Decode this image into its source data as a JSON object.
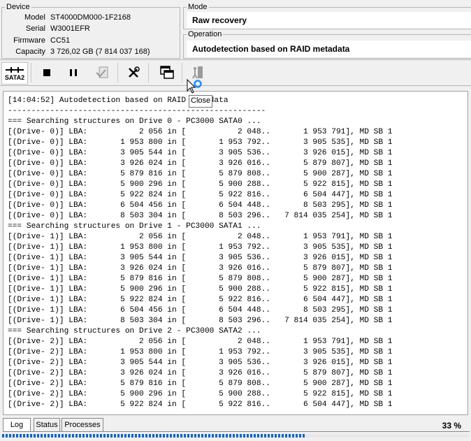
{
  "device": {
    "legend": "Device",
    "rows": [
      {
        "key": "Model",
        "value": "ST4000DM000-1F2168"
      },
      {
        "key": "Serial",
        "value": "W3001EFR"
      },
      {
        "key": "Firmware",
        "value": "CC51"
      },
      {
        "key": "Capacity",
        "value": "3 726,02 GB (7 814 037 168)"
      }
    ]
  },
  "mode": {
    "legend": "Mode",
    "value": "Raw recovery"
  },
  "operation": {
    "legend": "Operation",
    "value": "Autodetection based on RAID metadata"
  },
  "toolbar": {
    "sata_label": "SATA2",
    "tooltip": "Close"
  },
  "log": {
    "lines": [
      "[14:04:52] Autodetection based on RAID metadata",
      "-------------------------------------------------------",
      "=== Searching structures on Drive 0 - PC3000 SATA0 ...",
      "[(Drive- 0)] LBA:           2 056 in [           2 048..       1 953 791], MD SB 1",
      "[(Drive- 0)] LBA:       1 953 800 in [       1 953 792..       3 905 535], MD SB 1",
      "[(Drive- 0)] LBA:       3 905 544 in [       3 905 536..       3 926 015], MD SB 1",
      "[(Drive- 0)] LBA:       3 926 024 in [       3 926 016..       5 879 807], MD SB 1",
      "[(Drive- 0)] LBA:       5 879 816 in [       5 879 808..       5 900 287], MD SB 1",
      "[(Drive- 0)] LBA:       5 900 296 in [       5 900 288..       5 922 815], MD SB 1",
      "[(Drive- 0)] LBA:       5 922 824 in [       5 922 816..       6 504 447], MD SB 1",
      "[(Drive- 0)] LBA:       6 504 456 in [       6 504 448..       8 503 295], MD SB 1",
      "[(Drive- 0)] LBA:       8 503 304 in [       8 503 296..   7 814 035 254], MD SB 1",
      "=== Searching structures on Drive 1 - PC3000 SATA1 ...",
      "[(Drive- 1)] LBA:           2 056 in [           2 048..       1 953 791], MD SB 1",
      "[(Drive- 1)] LBA:       1 953 800 in [       1 953 792..       3 905 535], MD SB 1",
      "[(Drive- 1)] LBA:       3 905 544 in [       3 905 536..       3 926 015], MD SB 1",
      "[(Drive- 1)] LBA:       3 926 024 in [       3 926 016..       5 879 807], MD SB 1",
      "[(Drive- 1)] LBA:       5 879 816 in [       5 879 808..       5 900 287], MD SB 1",
      "[(Drive- 1)] LBA:       5 900 296 in [       5 900 288..       5 922 815], MD SB 1",
      "[(Drive- 1)] LBA:       5 922 824 in [       5 922 816..       6 504 447], MD SB 1",
      "[(Drive- 1)] LBA:       6 504 456 in [       6 504 448..       8 503 295], MD SB 1",
      "[(Drive- 1)] LBA:       8 503 304 in [       8 503 296..   7 814 035 254], MD SB 1",
      "=== Searching structures on Drive 2 - PC3000 SATA2 ...",
      "[(Drive- 2)] LBA:           2 056 in [           2 048..       1 953 791], MD SB 1",
      "[(Drive- 2)] LBA:       1 953 800 in [       1 953 792..       3 905 535], MD SB 1",
      "[(Drive- 2)] LBA:       3 905 544 in [       3 905 536..       3 926 015], MD SB 1",
      "[(Drive- 2)] LBA:       3 926 024 in [       3 926 016..       5 879 807], MD SB 1",
      "[(Drive- 2)] LBA:       5 879 816 in [       5 879 808..       5 900 287], MD SB 1",
      "[(Drive- 2)] LBA:       5 900 296 in [       5 900 288..       5 922 815], MD SB 1",
      "[(Drive- 2)] LBA:       5 922 824 in [       5 922 816..       6 504 447], MD SB 1"
    ]
  },
  "tabs": [
    {
      "label": "Log"
    },
    {
      "label": "Status"
    },
    {
      "label": "Processes"
    }
  ],
  "status": {
    "percent": "33 %",
    "progress_fraction": 0.33,
    "accent": "#0a64c8"
  }
}
